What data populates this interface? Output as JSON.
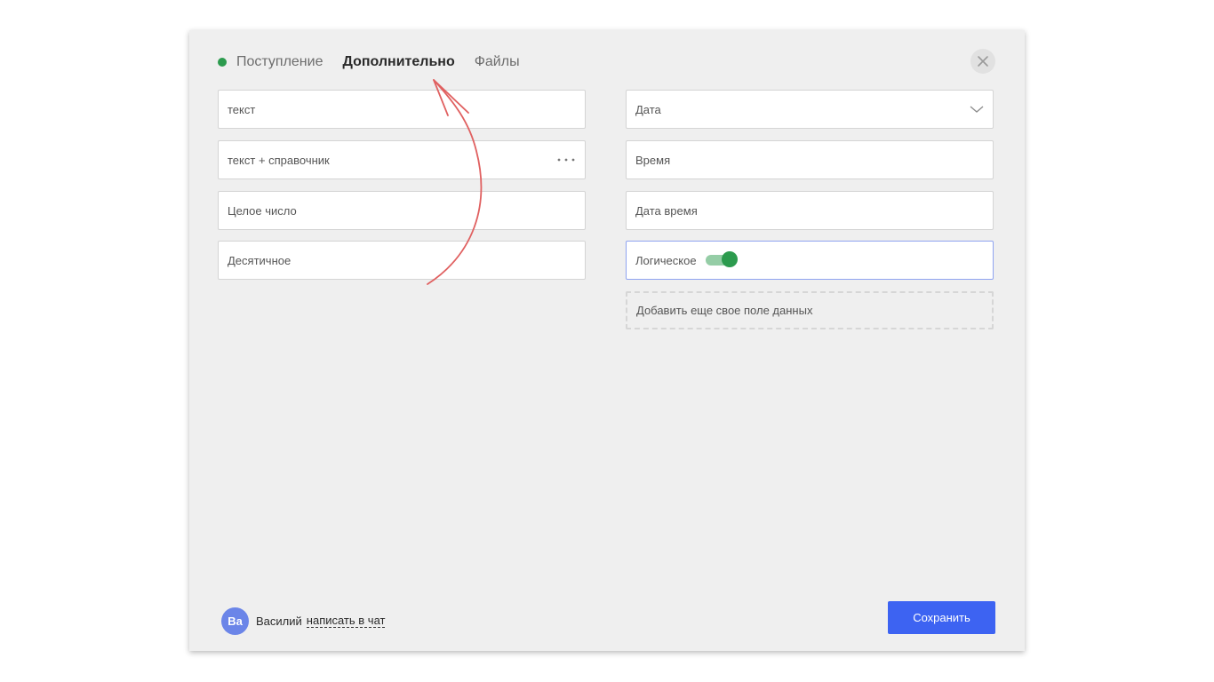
{
  "colors": {
    "status_dot": "#2c9b4e",
    "primary": "#3d63f2",
    "toggle_on": "#2c9b4e",
    "avatar_bg": "#6b85e8",
    "annotation": "#e06060"
  },
  "tabs": [
    {
      "label": "Поступление",
      "active": false
    },
    {
      "label": "Дополнительно",
      "active": true
    },
    {
      "label": "Файлы",
      "active": false
    }
  ],
  "close_icon": "close-icon",
  "left_fields": [
    {
      "label": "текст"
    },
    {
      "label": "текст + справочник",
      "icon": "more-dots-icon"
    },
    {
      "label": "Целое число"
    },
    {
      "label": "Десятичное"
    }
  ],
  "right_fields": [
    {
      "label": "Дата",
      "icon": "chevron-down-icon"
    },
    {
      "label": "Время"
    },
    {
      "label": "Дата время"
    },
    {
      "label": "Логическое",
      "toggle_on": true
    }
  ],
  "add_field": {
    "label": "Добавить еще свое поле данных"
  },
  "footer": {
    "avatar_initials": "Ва",
    "user_name": "Василий",
    "chat_link": "написать в чат",
    "save_label": "Сохранить"
  }
}
